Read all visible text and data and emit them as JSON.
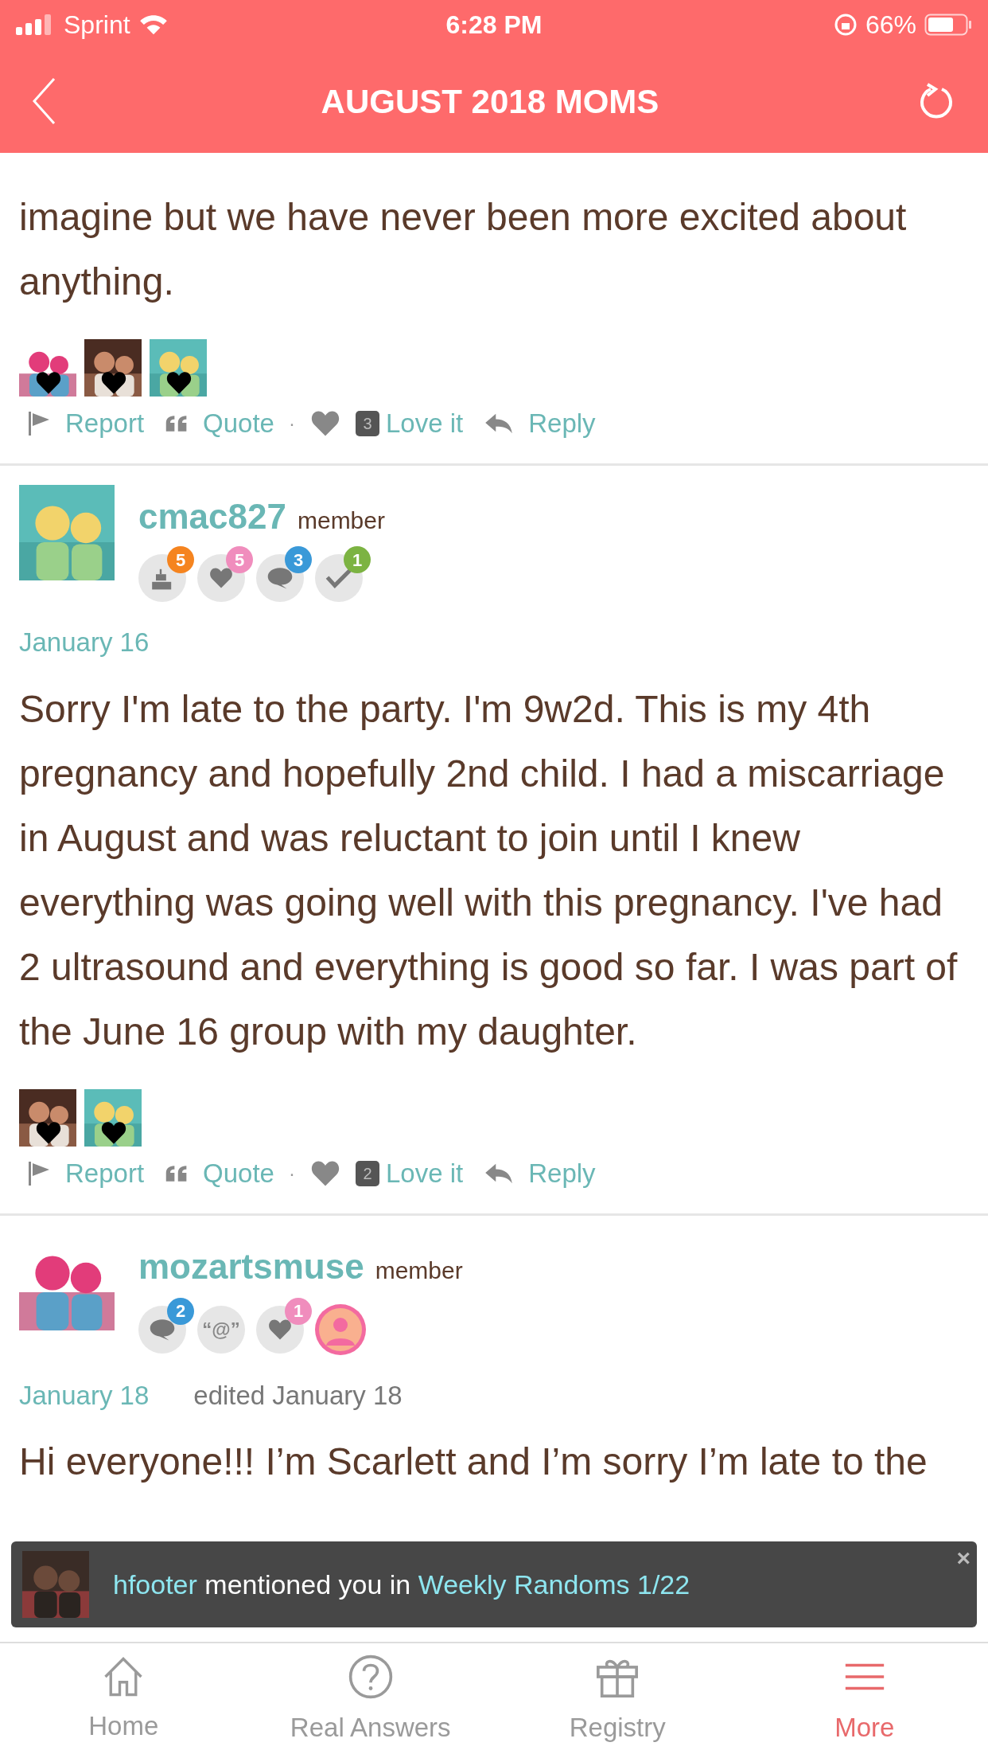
{
  "status_bar": {
    "carrier": "Sprint",
    "time": "6:28 PM",
    "battery": "66%"
  },
  "header": {
    "title": "AUGUST 2018 MOMS"
  },
  "posts": [
    {
      "body": "imagine but we have never been more excited about anything.",
      "actions": {
        "report": "Report",
        "quote": "Quote",
        "separator": "·",
        "love_count": "3",
        "love": "Love it",
        "reply": "Reply"
      }
    },
    {
      "author": {
        "name": "cmac827",
        "role": "member",
        "badges": [
          {
            "kind": "cake",
            "count": "5",
            "color": "#f5841f"
          },
          {
            "kind": "heart",
            "count": "5",
            "color": "#f08dbd"
          },
          {
            "kind": "chat",
            "count": "3",
            "color": "#3a99d8"
          },
          {
            "kind": "check",
            "count": "1",
            "color": "#7cb342"
          }
        ]
      },
      "date": "January 16",
      "body": "Sorry I'm late to the party. I'm 9w2d. This is my 4th pregnancy and hopefully 2nd child. I had a miscarriage in August and was reluctant to join until I knew everything was going well with this pregnancy. I've had 2 ultrasound and everything is good so far. I was part of the June 16 group with my daughter.",
      "actions": {
        "report": "Report",
        "quote": "Quote",
        "separator": "·",
        "love_count": "2",
        "love": "Love it",
        "reply": "Reply"
      }
    },
    {
      "author": {
        "name": "mozartsmuse",
        "role": "member",
        "badges": [
          {
            "kind": "chat",
            "count": "2",
            "color": "#3a99d8"
          },
          {
            "kind": "at",
            "label": "“@”"
          },
          {
            "kind": "heart",
            "count": "1",
            "color": "#f08dbd"
          },
          {
            "kind": "profile"
          }
        ]
      },
      "date": "January 18",
      "edited": "edited January 18",
      "body": "Hi everyone!!! I’m Scarlett and I’m sorry I’m late to the"
    }
  ],
  "toast": {
    "user": "hfooter",
    "text": "mentioned you in",
    "link": "Weekly Randoms 1/22",
    "close": "×"
  },
  "tab_bar": [
    {
      "label": "Home",
      "kind": "home",
      "selected": false
    },
    {
      "label": "Real Answers",
      "kind": "question",
      "selected": false
    },
    {
      "label": "Registry",
      "kind": "gift",
      "selected": false
    },
    {
      "label": "More",
      "kind": "menu",
      "selected": true
    }
  ]
}
